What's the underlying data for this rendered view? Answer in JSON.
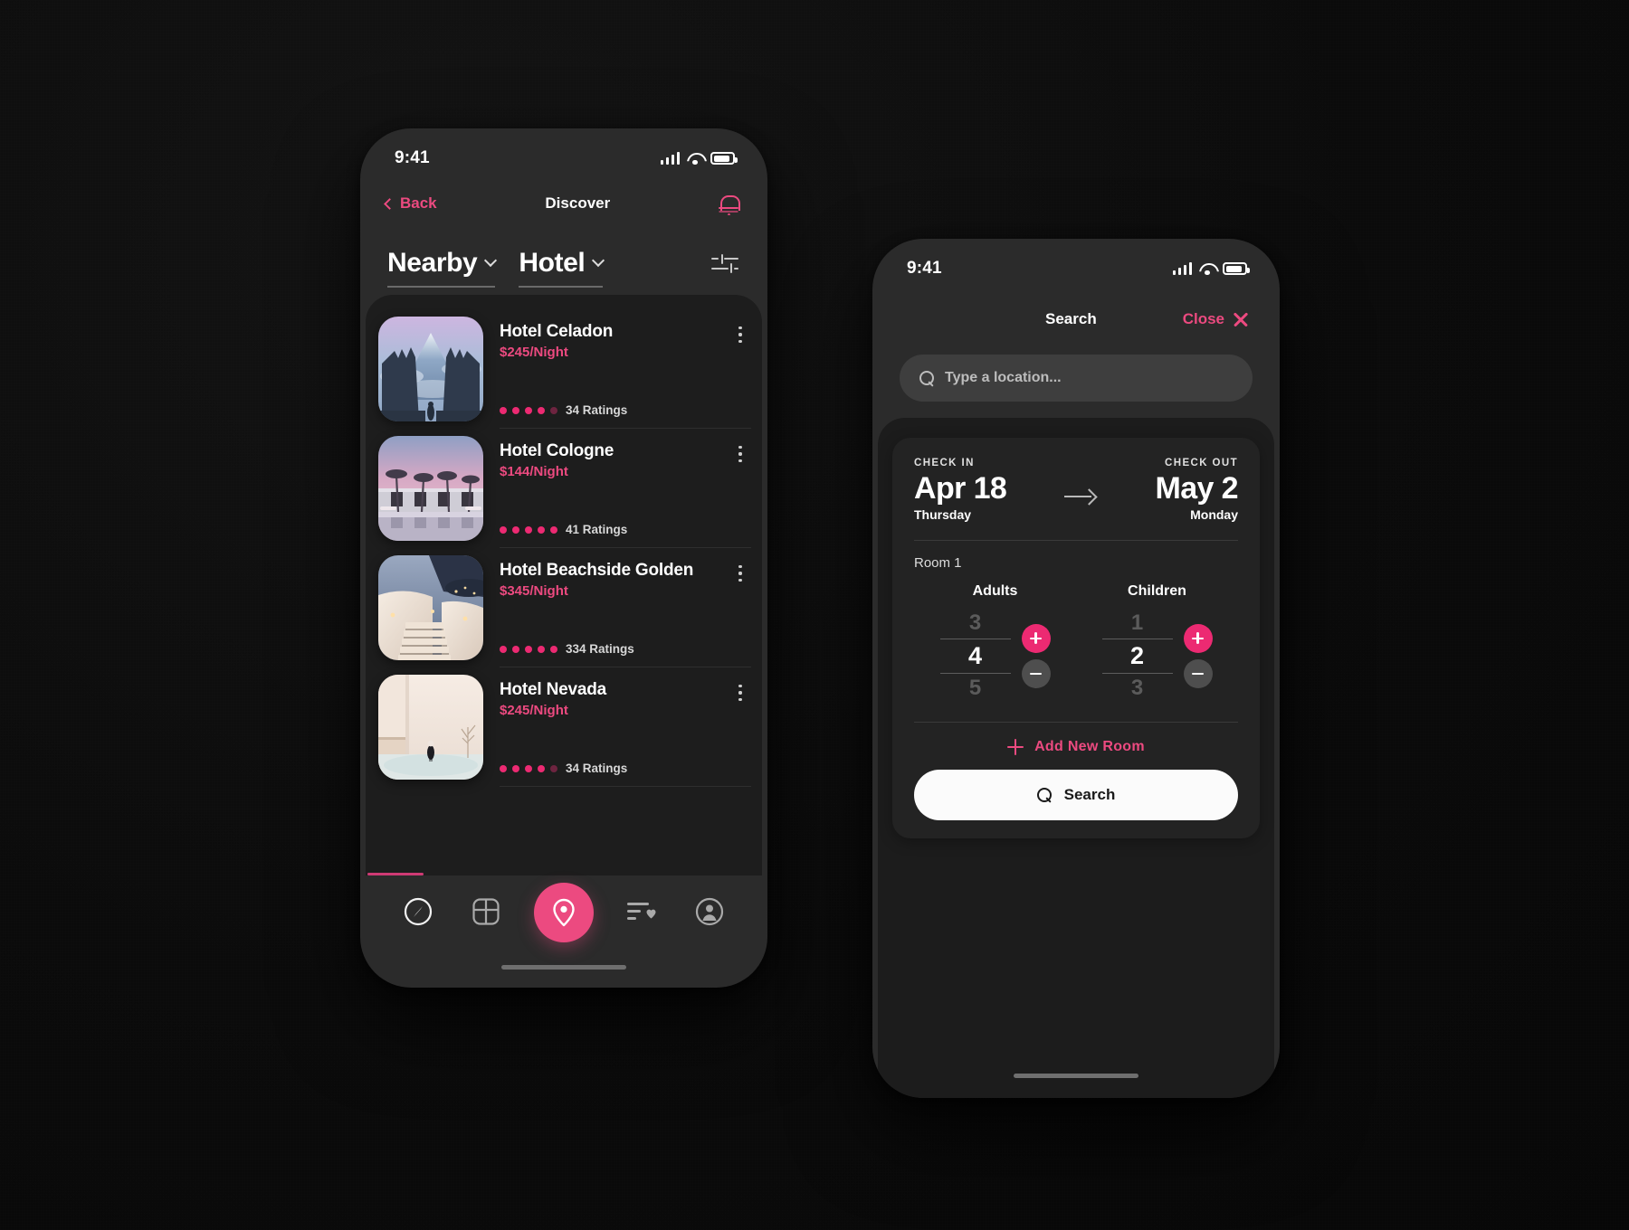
{
  "theme": {
    "accent": "#ec4a80",
    "accent_strong": "#ec2a72",
    "bg": "#0a0a0a",
    "panel": "#1d1d1d",
    "card": "#232323"
  },
  "phone_one": {
    "status": {
      "time": "9:41",
      "signal_icon": "cellular-bars-icon",
      "wifi_icon": "wifi-icon",
      "battery_icon": "battery-icon"
    },
    "nav": {
      "back_label": "Back",
      "title": "Discover",
      "bell_icon": "bell-icon"
    },
    "filters": [
      {
        "label": "Nearby",
        "chevron_icon": "chevron-down-icon"
      },
      {
        "label": "Hotel",
        "chevron_icon": "chevron-down-icon"
      }
    ],
    "filter_settings_icon": "sliders-icon",
    "hotels": [
      {
        "name": "Hotel Celadon",
        "price": "$245/Night",
        "ratings": "34 Ratings",
        "filled_dots": 4,
        "total_dots": 5,
        "thumb": "bali-temple-gate-thumb",
        "menu_icon": "kebab-menu-icon"
      },
      {
        "name": "Hotel Cologne",
        "price": "$144/Night",
        "ratings": "41 Ratings",
        "filled_dots": 5,
        "total_dots": 5,
        "thumb": "palm-resort-dusk-thumb",
        "menu_icon": "kebab-menu-icon"
      },
      {
        "name": "Hotel Beachside Golden",
        "price": "$345/Night",
        "ratings": "334 Ratings",
        "filled_dots": 5,
        "total_dots": 5,
        "thumb": "santorini-stairs-thumb",
        "menu_icon": "kebab-menu-icon"
      },
      {
        "name": "Hotel Nevada",
        "price": "$245/Night",
        "ratings": "34 Ratings",
        "filled_dots": 4,
        "total_dots": 5,
        "thumb": "minimal-white-interior-thumb",
        "menu_icon": "kebab-menu-icon"
      }
    ],
    "tabs": [
      {
        "name": "explore",
        "icon": "compass-icon",
        "active": false
      },
      {
        "name": "categories",
        "icon": "grid-icon",
        "active": false
      },
      {
        "name": "map",
        "icon": "location-pin-icon",
        "active": true
      },
      {
        "name": "saved",
        "icon": "list-heart-icon",
        "active": false
      },
      {
        "name": "profile",
        "icon": "user-circle-icon",
        "active": false
      }
    ]
  },
  "phone_two": {
    "status": {
      "time": "9:41",
      "signal_icon": "cellular-bars-icon",
      "wifi_icon": "wifi-icon",
      "battery_icon": "battery-icon"
    },
    "nav": {
      "title": "Search",
      "close_label": "Close",
      "close_icon": "close-x-icon"
    },
    "search": {
      "placeholder": "Type a location...",
      "value": "",
      "icon": "search-icon"
    },
    "stay": {
      "check_in_label": "CHECK IN",
      "check_in_date": "Apr 18",
      "check_in_day": "Thursday",
      "arrow_icon": "arrow-right-icon",
      "check_out_label": "CHECK OUT",
      "check_out_date": "May 2",
      "check_out_day": "Monday"
    },
    "room_label": "Room 1",
    "counters": [
      {
        "name": "Adults",
        "prev": "3",
        "value": "4",
        "next": "5",
        "plus_icon": "plus-icon",
        "minus_icon": "minus-icon"
      },
      {
        "name": "Children",
        "prev": "1",
        "value": "2",
        "next": "3",
        "plus_icon": "plus-icon",
        "minus_icon": "minus-icon"
      }
    ],
    "add_room_label": "Add New Room",
    "add_room_icon": "plus-icon",
    "search_button_label": "Search",
    "search_button_icon": "search-icon"
  }
}
